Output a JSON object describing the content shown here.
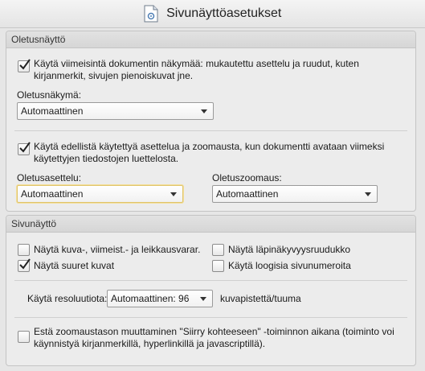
{
  "window": {
    "title": "Sivunäyttöasetukset"
  },
  "defaults": {
    "header": "Oletusnäyttö",
    "use_last_view_label": "Käytä viimeisintä dokumentin näkymää: mukautettu asettelu ja ruudut, kuten",
    "use_last_view_label_line2": "kirjanmerkit, sivujen pienoiskuvat jne.",
    "use_last_view_checked": true,
    "default_view_label": "Oletusnäkymä:",
    "default_view_value": "Automaattinen",
    "use_previous_label": "Käytä edellistä käytettyä asettelua ja zoomausta, kun dokumentti avataan viimeksi",
    "use_previous_label_line2": "käytettyjen tiedostojen  luettelosta.",
    "use_previous_checked": true,
    "default_layout_label": "Oletusasettelu:",
    "default_layout_value": "Automaattinen",
    "default_zoom_label": "Oletuszoomaus:",
    "default_zoom_value": "Automaattinen"
  },
  "page_display": {
    "header": "Sivunäyttö",
    "show_art_boxes_label": "Näytä kuva-, viimeist.- ja leikkausvarar.",
    "show_art_boxes_checked": false,
    "show_large_images_label": "Näytä suuret kuvat",
    "show_large_images_checked": true,
    "show_transparency_grid_label": "Näytä läpinäkyvyysruudukko",
    "show_transparency_grid_checked": false,
    "use_logical_page_numbers_label": "Käytä loogisia sivunumeroita",
    "use_logical_page_numbers_checked": false,
    "resolution_label": "Käytä resoluutiota:",
    "resolution_value": "Automaattinen: 96",
    "resolution_unit": "kuvapistettä/tuuma",
    "prevent_zoom_label": "Estä zoomaustason muuttaminen \"Siirry kohteeseen\" -toiminnon aikana (toiminto voi",
    "prevent_zoom_label_line2": "käynnistyä kirjanmerkillä, hyperlinkillä ja  javascriptillä).",
    "prevent_zoom_checked": false
  }
}
